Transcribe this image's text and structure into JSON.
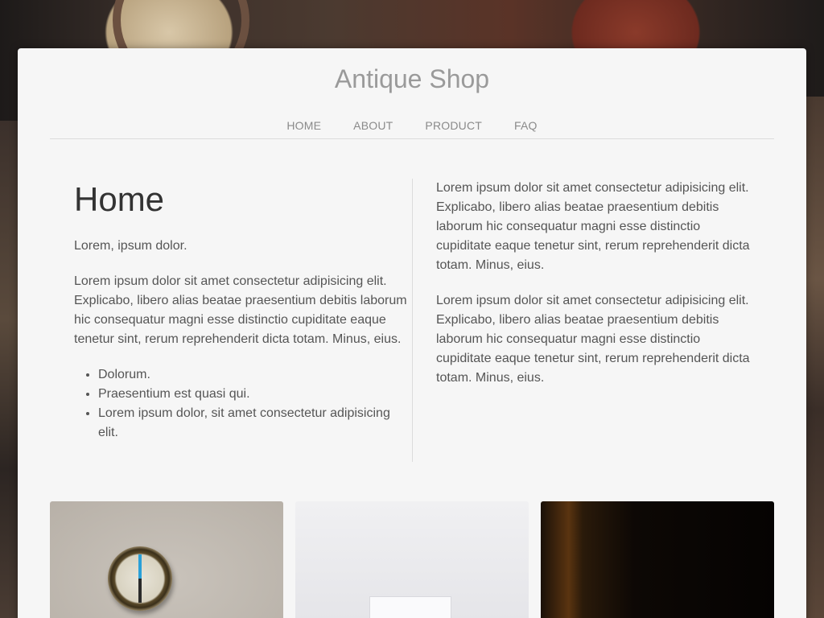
{
  "site": {
    "title": "Antique Shop"
  },
  "nav": {
    "items": [
      {
        "label": "HOME"
      },
      {
        "label": "ABOUT"
      },
      {
        "label": "PRODUCT"
      },
      {
        "label": "FAQ"
      }
    ]
  },
  "main": {
    "heading": "Home",
    "intro": "Lorem, ipsum dolor.",
    "paragraph": "Lorem ipsum dolor sit amet consectetur adipisicing elit. Explicabo, libero alias beatae praesentium debitis laborum hic consequatur magni esse distinctio cupiditate eaque tenetur sint, rerum reprehenderit dicta totam. Minus, eius.",
    "list": [
      "Dolorum.",
      "Praesentium est quasi qui.",
      "Lorem ipsum dolor, sit amet consectetur adipisicing elit."
    ],
    "right_paragraphs": [
      "Lorem ipsum dolor sit amet consectetur adipisicing elit. Explicabo, libero alias beatae praesentium debitis laborum hic consequatur magni esse distinctio cupiditate eaque tenetur sint, rerum reprehenderit dicta totam. Minus, eius.",
      "Lorem ipsum dolor sit amet consectetur adipisicing elit. Explicabo, libero alias beatae praesentium debitis laborum hic consequatur magni esse distinctio cupiditate eaque tenetur sint, rerum reprehenderit dicta totam. Minus, eius."
    ]
  },
  "tiles": [
    {
      "icon": "compass-photo"
    },
    {
      "icon": "white-box-photo"
    },
    {
      "icon": "dark-lamp-photo"
    }
  ],
  "colors": {
    "card_bg": "#f6f6f6",
    "title": "#9a9a9a",
    "text": "#555555"
  }
}
